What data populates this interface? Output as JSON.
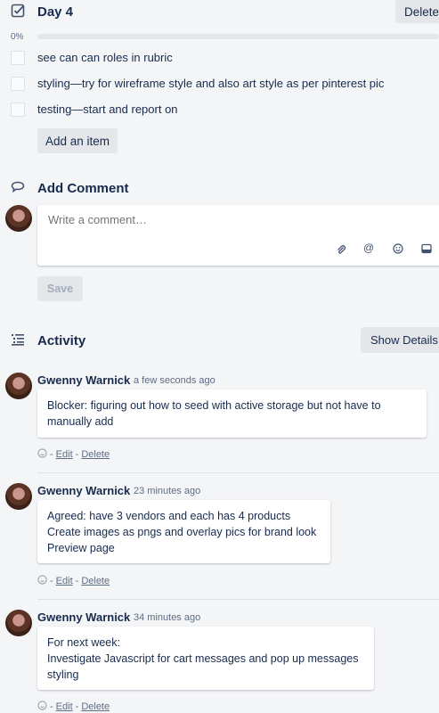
{
  "checklist": {
    "title": "Day 4",
    "delete_label": "Delete",
    "progress_label": "0%",
    "progress_value": 0,
    "items": [
      {
        "text": "see can can roles in rubric"
      },
      {
        "text": "styling—try for wireframe style and also art style as per pinterest pic"
      },
      {
        "text": "testing—start and report on"
      }
    ],
    "add_item_label": "Add an item"
  },
  "add_comment": {
    "title": "Add Comment",
    "placeholder": "Write a comment…",
    "save_label": "Save",
    "icons": [
      "attachment-icon",
      "mention-icon",
      "emoji-icon",
      "card-icon"
    ]
  },
  "activity": {
    "title": "Activity",
    "show_details_label": "Show Details",
    "entries": [
      {
        "author": "Gwenny Warnick",
        "time": "a few seconds ago",
        "lines": [
          "Blocker: figuring out how to seed with active storage but not have to",
          "manually add"
        ],
        "edit_label": "Edit",
        "delete_label": "Delete"
      },
      {
        "author": "Gwenny Warnick",
        "time": "23 minutes ago",
        "lines": [
          "Agreed: have 3 vendors and each has 4 products",
          "Create images as pngs and overlay pics for brand look",
          "Preview page"
        ],
        "edit_label": "Edit",
        "delete_label": "Delete"
      },
      {
        "author": "Gwenny Warnick",
        "time": "34 minutes ago",
        "lines": [
          "For next week:",
          "Investigate Javascript for cart messages and pop up messages",
          "styling"
        ],
        "edit_label": "Edit",
        "delete_label": "Delete"
      }
    ]
  },
  "colors": {
    "background": "#f4f5f7",
    "text": "#172b4d",
    "muted": "#5e6c84",
    "button": "#e4e6ea"
  }
}
